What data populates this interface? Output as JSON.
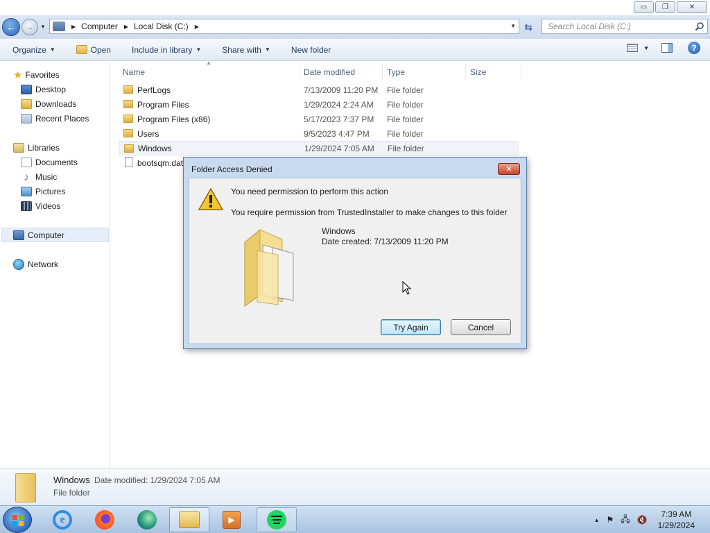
{
  "window": {
    "minimize_glyph": "▭",
    "maximize_glyph": "❐",
    "close_glyph": "✕"
  },
  "nav": {
    "back_glyph": "←",
    "forward_glyph": "→",
    "breadcrumbs": [
      "Computer",
      "Local Disk (C:)"
    ],
    "refresh_glyph": "⇆",
    "search_placeholder": "Search Local Disk (C:)"
  },
  "toolbar": {
    "organize": "Organize",
    "open": "Open",
    "include_in_library": "Include in library",
    "share_with": "Share with",
    "new_folder": "New folder",
    "help_glyph": "?"
  },
  "sidebar": {
    "favorites": "Favorites",
    "desktop": "Desktop",
    "downloads": "Downloads",
    "recent_places": "Recent Places",
    "libraries": "Libraries",
    "documents": "Documents",
    "music": "Music",
    "pictures": "Pictures",
    "videos": "Videos",
    "computer": "Computer",
    "network": "Network"
  },
  "columns": {
    "name": "Name",
    "date_modified": "Date modified",
    "type": "Type",
    "size": "Size"
  },
  "files": [
    {
      "name": "PerfLogs",
      "date": "7/13/2009 11:20 PM",
      "type": "File folder"
    },
    {
      "name": "Program Files",
      "date": "1/29/2024 2:24 AM",
      "type": "File folder"
    },
    {
      "name": "Program Files (x86)",
      "date": "5/17/2023 7:37 PM",
      "type": "File folder"
    },
    {
      "name": "Users",
      "date": "9/5/2023 4:47 PM",
      "type": "File folder"
    },
    {
      "name": "Windows",
      "date": "1/29/2024 7:05 AM",
      "type": "File folder"
    },
    {
      "name": "bootsqm.dat",
      "date": "",
      "type": ""
    }
  ],
  "details": {
    "name": "Windows",
    "meta": "Date modified: 1/29/2024 7:05 AM",
    "type": "File folder"
  },
  "dialog": {
    "title": "Folder Access Denied",
    "close_glyph": "✕",
    "message1": "You need permission to perform this action",
    "message2": "You require permission from TrustedInstaller to make changes to this folder",
    "folder_name": "Windows",
    "folder_date": "Date created: 7/13/2009 11:20 PM",
    "try_again": "Try Again",
    "cancel": "Cancel"
  },
  "taskbar": {
    "ie_glyph": "e",
    "media_glyph": "▶",
    "tray_up_glyph": "▲",
    "flag_glyph": "⚑",
    "network_glyph": "🖧",
    "volume_glyph": "🔇",
    "time": "7:39 AM",
    "date": "1/29/2024"
  },
  "colors": {
    "titlebar": "#dce7f5",
    "selection": "#e5eef9",
    "dialog_frame": "#c8daf0",
    "close_red": "#c4452d",
    "spotify_green": "#1ed760"
  }
}
